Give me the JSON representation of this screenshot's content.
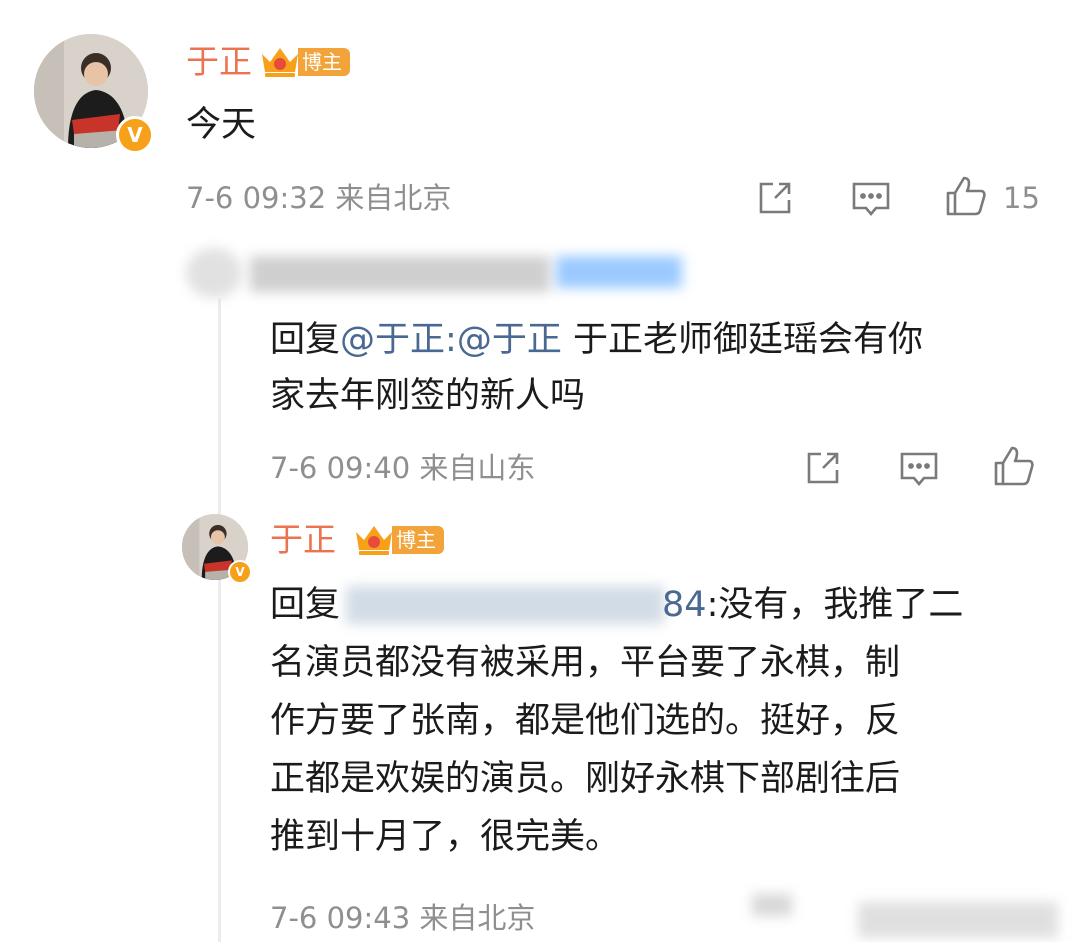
{
  "post": {
    "username": "于正",
    "tag": "博主",
    "verified_mark": "V",
    "text": "今天",
    "time": "7-6 09:32",
    "location": "来自北京",
    "like_count": "15",
    "icons": [
      "share-icon",
      "comment-icon",
      "like-icon"
    ]
  },
  "reply1": {
    "reply_prefix": "回复",
    "mention1": "@于正",
    "colon": ":",
    "mention2": "@于正",
    "text_line1": " 于正老师御廷瑶会有你",
    "text_line2": "家去年刚签的新人吗",
    "time": "7-6 09:40",
    "location": "来自山东"
  },
  "reply2": {
    "username": "于正",
    "tag": "博主",
    "verified_mark": "V",
    "reply_prefix": "回复",
    "mention_tail": "84",
    "line1": ":没有，我推了二",
    "line2": "名演员都没有被采用，平台要了永棋，制",
    "line3": "作方要了张南，都是他们选的。挺好，反",
    "line4": "正都是欢娱的演员。刚好永棋下部剧往后",
    "line5": "推到十月了，很完美。",
    "time": "7-6 09:43",
    "location": "来自北京"
  },
  "colors": {
    "username": "#eb7350",
    "mention": "#496992",
    "meta": "#8f8f8f",
    "badge": "#f7a01a",
    "tag": "#f2a33a"
  }
}
